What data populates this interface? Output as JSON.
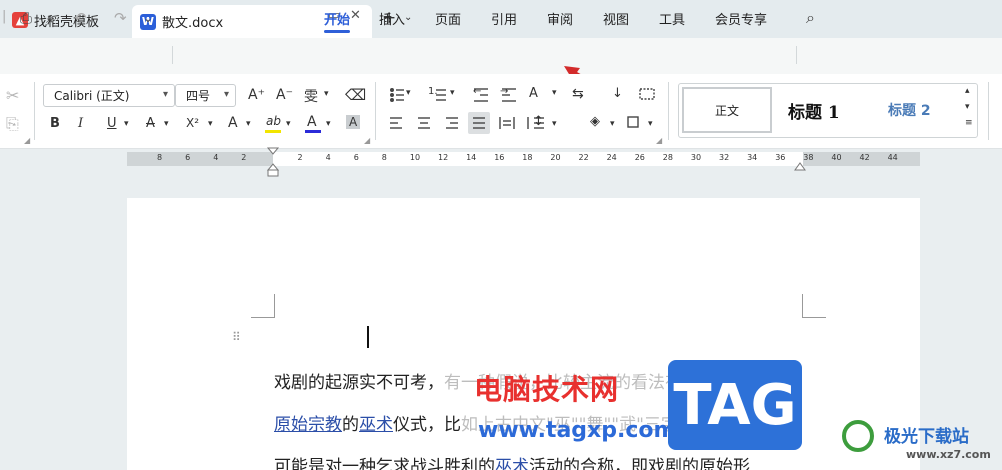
{
  "tabs": [
    {
      "label": "找稻壳模板",
      "icon": "docer-icon"
    },
    {
      "label": "散文.docx",
      "icon": "word-doc-icon",
      "icon_letter": "W"
    }
  ],
  "tab_controls": {
    "restore": "▭",
    "close": "✕",
    "new": "+",
    "caret": "⌄"
  },
  "quick_access": {
    "file_sep": "|",
    "print": "⎙",
    "preview": "⌕",
    "undo": "↶",
    "redo": "↷",
    "more": "⌄"
  },
  "menu": {
    "items": [
      "开始",
      "插入",
      "页面",
      "引用",
      "审阅",
      "视图",
      "工具",
      "会员专享"
    ],
    "active": "开始",
    "search_icon": "⌕"
  },
  "ribbon": {
    "font_name": "Calibri (正文)",
    "font_size": "四号",
    "grow": "A⁺",
    "shrink": "A⁻",
    "phonetic": "雯",
    "clear": "⌫",
    "bold": "B",
    "italic": "I",
    "underline": "U",
    "strike": "A",
    "superscript": "X²",
    "effects": "A",
    "highlight": "ab",
    "font_color": "A",
    "char_shade": "A",
    "highlight_color": "#f2e500",
    "font_color_value": "#2b2bd9",
    "cut": "✂",
    "copy": "⎘",
    "styles": {
      "normal": "正文",
      "heading1": "标题 1",
      "heading2": "标题 2"
    }
  },
  "ruler": {
    "ticks": [
      "8",
      "6",
      "4",
      "2",
      "2",
      "4",
      "6",
      "8",
      "10",
      "12",
      "14",
      "16",
      "18",
      "20",
      "22",
      "24",
      "26",
      "28",
      "30",
      "32",
      "34",
      "36",
      "38",
      "40",
      "42",
      "44"
    ]
  },
  "document": {
    "line1_a": "戏剧的起源实不可考，",
    "line1_b": "有一种假说，比较主流的看法有三：一为",
    "line2_link1": "原始宗教",
    "line2_a": "的",
    "line2_link2": "巫术",
    "line2_b": "仪式，比",
    "line2_c": "如上古中文\"巫\"\"舞\"\"武\"三字同",
    "line3_a": "可能是对一种乞求战斗胜利的",
    "line3_link": "巫术",
    "line3_b": "活动的合称，即戏剧的原始形"
  },
  "watermark": {
    "cn": "电脑技术网",
    "url": "www.tagxp.com",
    "tag": "TAG",
    "site": "极光下载站",
    "site_url": "www.xz7.com"
  }
}
